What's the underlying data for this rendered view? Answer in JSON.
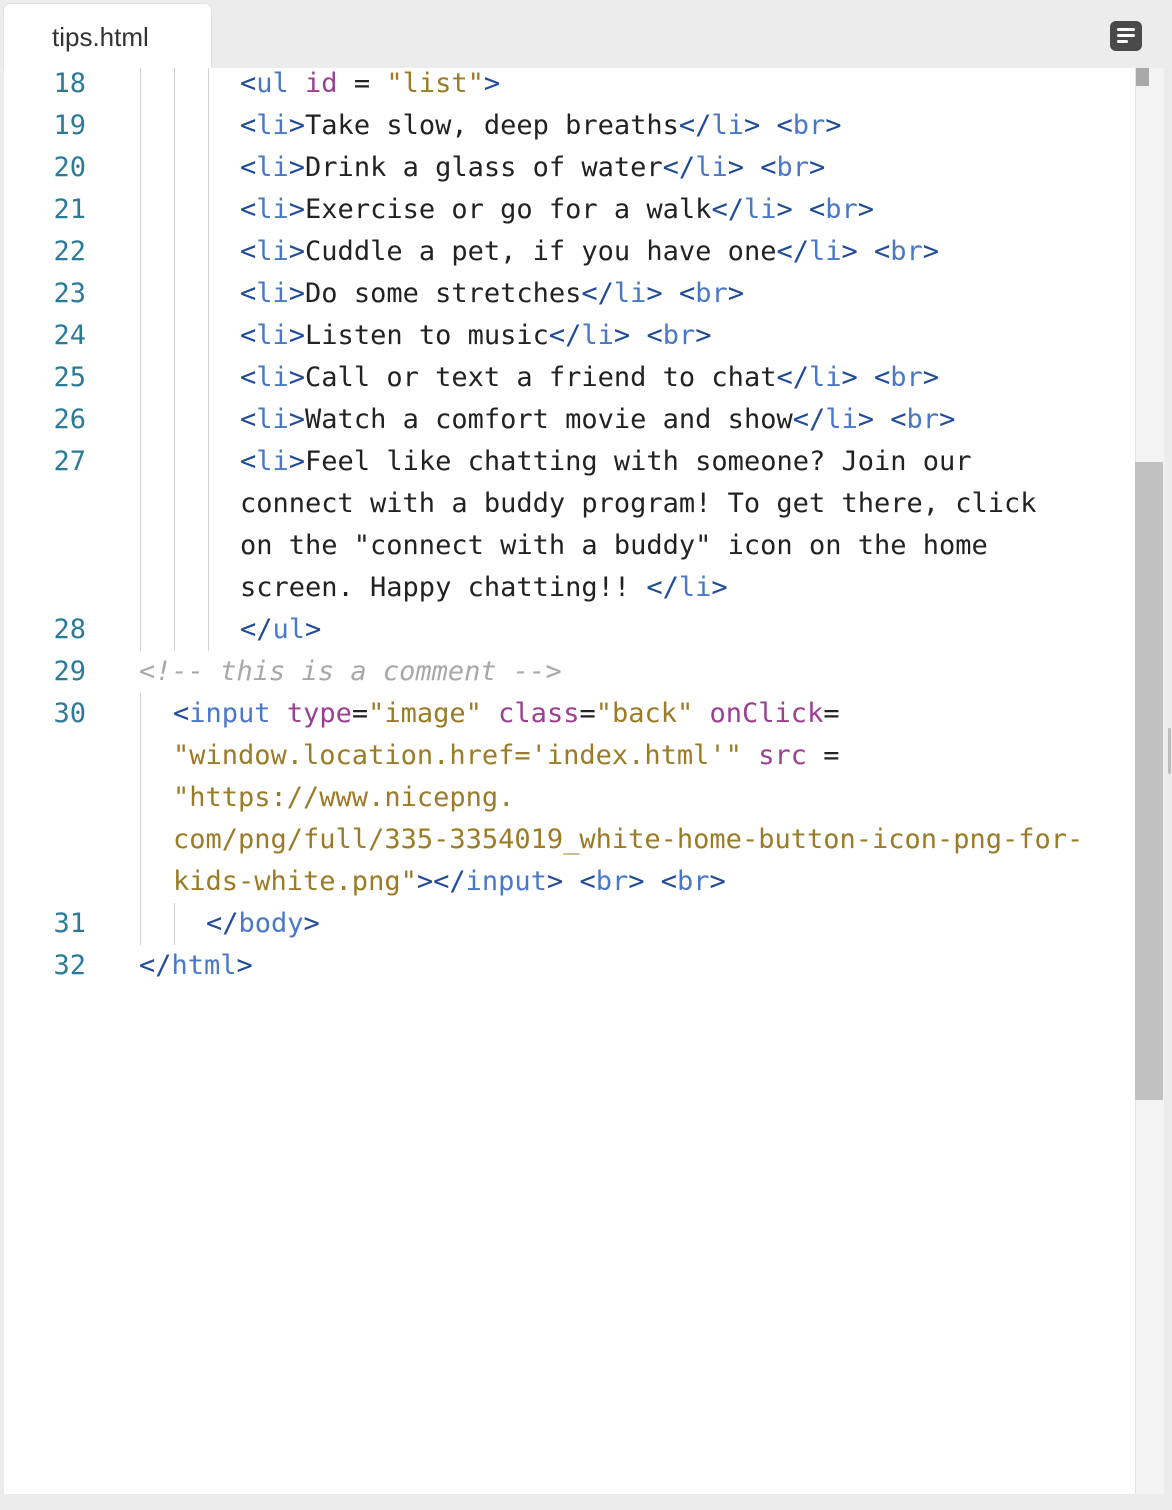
{
  "tab": {
    "filename": "tips.html"
  },
  "icons": {
    "menu": "lines-menu-icon"
  },
  "colors": {
    "line_number": "#2b7a99",
    "tag_bracket": "#1f4b99",
    "tag_name": "#4a78c8",
    "attribute": "#9a3f92",
    "string": "#9c7b27",
    "comment": "#a8a8a8",
    "text": "#222222"
  },
  "lines": [
    {
      "num": "18",
      "tokens": [
        [
          "tg",
          "<"
        ],
        [
          "tn",
          "ul"
        ],
        [
          "txt",
          " "
        ],
        [
          "at",
          "id"
        ],
        [
          "txt",
          " = "
        ],
        [
          "st",
          "\"list\""
        ],
        [
          "tg",
          ">"
        ]
      ]
    },
    {
      "num": "19",
      "tokens": [
        [
          "tg",
          "<"
        ],
        [
          "tn",
          "li"
        ],
        [
          "tg",
          ">"
        ],
        [
          "txt",
          "Take slow, deep breaths"
        ],
        [
          "tg",
          "</"
        ],
        [
          "tn",
          "li"
        ],
        [
          "tg",
          ">"
        ],
        [
          "txt",
          " "
        ],
        [
          "tg",
          "<"
        ],
        [
          "tn",
          "br"
        ],
        [
          "tg",
          ">"
        ]
      ]
    },
    {
      "num": "20",
      "tokens": [
        [
          "tg",
          "<"
        ],
        [
          "tn",
          "li"
        ],
        [
          "tg",
          ">"
        ],
        [
          "txt",
          "Drink a glass of water"
        ],
        [
          "tg",
          "</"
        ],
        [
          "tn",
          "li"
        ],
        [
          "tg",
          ">"
        ],
        [
          "txt",
          " "
        ],
        [
          "tg",
          "<"
        ],
        [
          "tn",
          "br"
        ],
        [
          "tg",
          ">"
        ]
      ]
    },
    {
      "num": "21",
      "tokens": [
        [
          "tg",
          "<"
        ],
        [
          "tn",
          "li"
        ],
        [
          "tg",
          ">"
        ],
        [
          "txt",
          "Exercise or go for a walk"
        ],
        [
          "tg",
          "</"
        ],
        [
          "tn",
          "li"
        ],
        [
          "tg",
          ">"
        ],
        [
          "txt",
          " "
        ],
        [
          "tg",
          "<"
        ],
        [
          "tn",
          "br"
        ],
        [
          "tg",
          ">"
        ]
      ]
    },
    {
      "num": "22",
      "tokens": [
        [
          "tg",
          "<"
        ],
        [
          "tn",
          "li"
        ],
        [
          "tg",
          ">"
        ],
        [
          "txt",
          "Cuddle a pet, if you have one"
        ],
        [
          "tg",
          "</"
        ],
        [
          "tn",
          "li"
        ],
        [
          "tg",
          ">"
        ],
        [
          "txt",
          " "
        ],
        [
          "tg",
          "<"
        ],
        [
          "tn",
          "br"
        ],
        [
          "tg",
          ">"
        ]
      ]
    },
    {
      "num": "23",
      "tokens": [
        [
          "tg",
          "<"
        ],
        [
          "tn",
          "li"
        ],
        [
          "tg",
          ">"
        ],
        [
          "txt",
          "Do some stretches"
        ],
        [
          "tg",
          "</"
        ],
        [
          "tn",
          "li"
        ],
        [
          "tg",
          ">"
        ],
        [
          "txt",
          " "
        ],
        [
          "tg",
          "<"
        ],
        [
          "tn",
          "br"
        ],
        [
          "tg",
          ">"
        ]
      ]
    },
    {
      "num": "24",
      "tokens": [
        [
          "tg",
          "<"
        ],
        [
          "tn",
          "li"
        ],
        [
          "tg",
          ">"
        ],
        [
          "txt",
          "Listen to music"
        ],
        [
          "tg",
          "</"
        ],
        [
          "tn",
          "li"
        ],
        [
          "tg",
          ">"
        ],
        [
          "txt",
          " "
        ],
        [
          "tg",
          "<"
        ],
        [
          "tn",
          "br"
        ],
        [
          "tg",
          ">"
        ]
      ]
    },
    {
      "num": "25",
      "tokens": [
        [
          "tg",
          "<"
        ],
        [
          "tn",
          "li"
        ],
        [
          "tg",
          ">"
        ],
        [
          "txt",
          "Call or text a friend to chat"
        ],
        [
          "tg",
          "</"
        ],
        [
          "tn",
          "li"
        ],
        [
          "tg",
          ">"
        ],
        [
          "txt",
          " "
        ],
        [
          "tg",
          "<"
        ],
        [
          "tn",
          "br"
        ],
        [
          "tg",
          ">"
        ]
      ]
    },
    {
      "num": "26",
      "tokens": [
        [
          "tg",
          "<"
        ],
        [
          "tn",
          "li"
        ],
        [
          "tg",
          ">"
        ],
        [
          "txt",
          "Watch a comfort movie and show"
        ],
        [
          "tg",
          "</"
        ],
        [
          "tn",
          "li"
        ],
        [
          "tg",
          ">"
        ],
        [
          "txt",
          " "
        ],
        [
          "tg",
          "<"
        ],
        [
          "tn",
          "br"
        ],
        [
          "tg",
          ">"
        ]
      ]
    },
    {
      "num": "27",
      "tokens": [
        [
          "tg",
          "<"
        ],
        [
          "tn",
          "li"
        ],
        [
          "tg",
          ">"
        ],
        [
          "txt",
          "Feel like chatting with someone? Join our"
        ]
      ]
    },
    {
      "num": "",
      "tokens": [
        [
          "txt",
          "connect with a buddy program! To get there, click"
        ]
      ]
    },
    {
      "num": "",
      "tokens": [
        [
          "txt",
          "on the \"connect with a buddy\" icon on the home"
        ]
      ]
    },
    {
      "num": "",
      "tokens": [
        [
          "txt",
          "screen. Happy chatting!! "
        ],
        [
          "tg",
          "</"
        ],
        [
          "tn",
          "li"
        ],
        [
          "tg",
          ">"
        ]
      ]
    },
    {
      "num": "28",
      "tokens": [
        [
          "tg",
          "</"
        ],
        [
          "tn",
          "ul"
        ],
        [
          "tg",
          ">"
        ]
      ]
    },
    {
      "num": "29",
      "tokens": [
        [
          "cm",
          "<!-- this is a comment -->"
        ]
      ]
    },
    {
      "num": "30",
      "tokens": [
        [
          "tg",
          "<"
        ],
        [
          "tn",
          "input"
        ],
        [
          "txt",
          " "
        ],
        [
          "at",
          "type"
        ],
        [
          "txt",
          "="
        ],
        [
          "st",
          "\"image\""
        ],
        [
          "txt",
          " "
        ],
        [
          "at",
          "class"
        ],
        [
          "txt",
          "="
        ],
        [
          "st",
          "\"back\""
        ],
        [
          "txt",
          " "
        ],
        [
          "at",
          "onClick"
        ],
        [
          "txt",
          "="
        ]
      ]
    },
    {
      "num": "",
      "tokens": [
        [
          "st",
          "\"window.location.href='index.html'\""
        ],
        [
          "txt",
          " "
        ],
        [
          "at",
          "src"
        ],
        [
          "txt",
          " ="
        ]
      ]
    },
    {
      "num": "",
      "tokens": [
        [
          "st",
          "\"https://www.nicepng."
        ]
      ]
    },
    {
      "num": "",
      "tokens": [
        [
          "st",
          "com/png/full/335-3354019_white-home-button-icon-png-for-"
        ]
      ]
    },
    {
      "num": "",
      "tokens": [
        [
          "st",
          "kids-white.png\""
        ],
        [
          "tg",
          "></"
        ],
        [
          "tn",
          "input"
        ],
        [
          "tg",
          ">"
        ],
        [
          "txt",
          " "
        ],
        [
          "tg",
          "<"
        ],
        [
          "tn",
          "br"
        ],
        [
          "tg",
          ">"
        ],
        [
          "txt",
          " "
        ],
        [
          "tg",
          "<"
        ],
        [
          "tn",
          "br"
        ],
        [
          "tg",
          ">"
        ]
      ]
    },
    {
      "num": "31",
      "tokens": [
        [
          "tg",
          "</"
        ],
        [
          "tn",
          "body"
        ],
        [
          "tg",
          ">"
        ]
      ]
    },
    {
      "num": "32",
      "tokens": [
        [
          "tg",
          "</"
        ],
        [
          "tn",
          "html"
        ],
        [
          "tg",
          ">"
        ]
      ]
    }
  ]
}
